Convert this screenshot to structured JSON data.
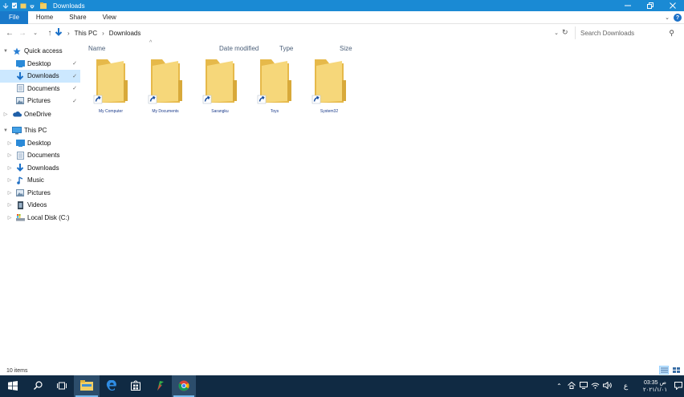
{
  "window": {
    "title": "Downloads"
  },
  "ribbon": {
    "tabs": [
      "File",
      "Home",
      "Share",
      "View"
    ]
  },
  "address": {
    "breadcrumbs": [
      "This PC",
      "Downloads"
    ]
  },
  "search": {
    "placeholder": "Search Downloads"
  },
  "nav": {
    "quick_access": {
      "label": "Quick access",
      "items": [
        "Desktop",
        "Downloads",
        "Documents",
        "Pictures"
      ]
    },
    "onedrive": "OneDrive",
    "this_pc": {
      "label": "This PC",
      "items": [
        "Desktop",
        "Documents",
        "Downloads",
        "Music",
        "Pictures",
        "Videos",
        "Local Disk (C:)"
      ]
    }
  },
  "columns": [
    "Name",
    "Date modified",
    "Type",
    "Size"
  ],
  "files": [
    "My Computer",
    "My Documents",
    "Sarangku",
    "Toys",
    "System32"
  ],
  "status": {
    "items": "10 items"
  },
  "clock": {
    "time": "03:35 ص",
    "date": "٢٠٢١/١/٠١"
  },
  "tray": {
    "lang": "ع"
  },
  "colors": {
    "titlebar": "#1a8ad4",
    "taskbar": "#102a43",
    "folder": "#f3cf63",
    "selection": "#cce8ff"
  }
}
